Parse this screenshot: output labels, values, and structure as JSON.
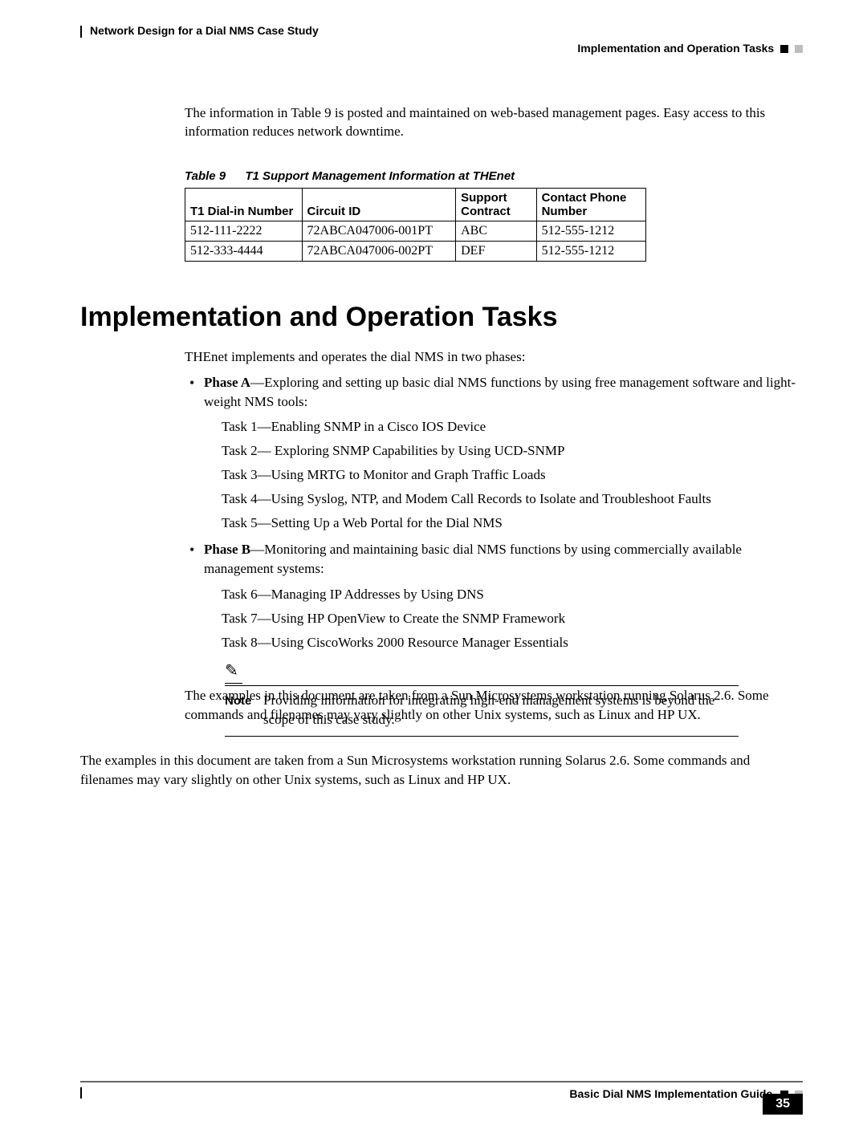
{
  "header": {
    "chapter": "Network Design for a Dial NMS Case Study",
    "section": "Implementation and Operation Tasks"
  },
  "intro": "The information in Table 9 is posted and maintained on web-based management pages. Easy access to this information reduces network downtime.",
  "table": {
    "label": "Table 9",
    "title": "T1 Support Management Information at THEnet",
    "headers": [
      "T1 Dial-in Number",
      "Circuit ID",
      "Support Contract",
      "Contact Phone Number"
    ],
    "rows": [
      [
        "512-111-2222",
        "72ABCA047006-001PT",
        "ABC",
        "512-555-1212"
      ],
      [
        "512-333-4444",
        "72ABCA047006-002PT",
        "DEF",
        "512-555-1212"
      ]
    ]
  },
  "heading": "Implementation and Operation Tasks",
  "phases_intro": "THEnet implements and operates the dial NMS in two phases:",
  "phaseA": {
    "label": "Phase A",
    "desc": "—Exploring and setting up basic dial NMS functions by using free management software and light-weight NMS tools:",
    "tasks": [
      "Task 1—Enabling SNMP in a Cisco IOS Device",
      "Task 2— Exploring SNMP Capabilities by Using UCD-SNMP",
      "Task 3—Using MRTG to Monitor and Graph Traffic Loads",
      "Task 4—Using Syslog, NTP, and Modem Call Records to Isolate and Troubleshoot Faults",
      "Task 5—Setting Up a Web Portal for the Dial NMS"
    ]
  },
  "phaseB": {
    "label": "Phase B",
    "desc": "—Monitoring and maintaining basic dial NMS functions by using commercially available management systems:",
    "tasks": [
      "Task 6—Managing IP Addresses by Using DNS",
      "Task 7—Using HP OpenView to Create the SNMP Framework",
      "Task 8—Using CiscoWorks 2000 Resource Manager Essentials"
    ]
  },
  "note": {
    "label": "Note",
    "text": "Providing information for integrating high-end management systems is beyond the scope of this case study."
  },
  "closing": "The examples in this document are taken from a Sun Microsystems workstation running Solarus 2.6. Some commands and filenames may vary slightly on other Unix systems, such as Linux and HP UX.",
  "footer": {
    "guide": "Basic Dial NMS Implementation Guide",
    "page": "35"
  }
}
